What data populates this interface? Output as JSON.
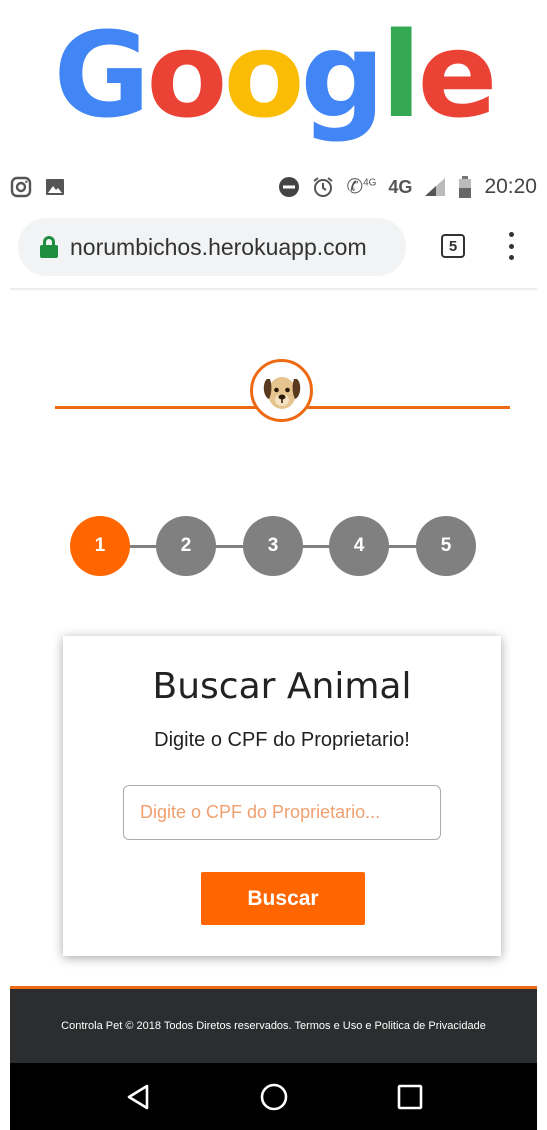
{
  "logo": {
    "letters": [
      "G",
      "o",
      "o",
      "g",
      "l",
      "e"
    ]
  },
  "status_bar": {
    "left_icons": [
      "instagram-icon",
      "image-icon"
    ],
    "right_icons": [
      "do-not-disturb-icon",
      "alarm-icon",
      "volte-call-icon",
      "network-4g-icon",
      "signal-icon",
      "battery-icon"
    ],
    "call_label": "4G",
    "network_label": "4G",
    "time": "20:20"
  },
  "browser": {
    "url": "norumbichos.herokuapp.com",
    "tab_count": "5"
  },
  "steps": [
    "1",
    "2",
    "3",
    "4",
    "5"
  ],
  "active_step": "1",
  "card": {
    "title": "Buscar Animal",
    "subtitle": "Digite o CPF do Proprietario!",
    "input_placeholder": "Digite o CPF do Proprietario...",
    "input_value": "",
    "button_label": "Buscar"
  },
  "footer": {
    "text": "Controla Pet © 2018 Todos Diretos reservados. Termos e Uso e Politica de Privacidade"
  },
  "colors": {
    "accent": "#ff6600",
    "step_inactive": "#808080",
    "footer_bg": "#2b2d2f",
    "google_blue": "#4285f4",
    "google_red": "#ea4335",
    "google_yellow": "#fbbc05",
    "google_green": "#34a853"
  }
}
